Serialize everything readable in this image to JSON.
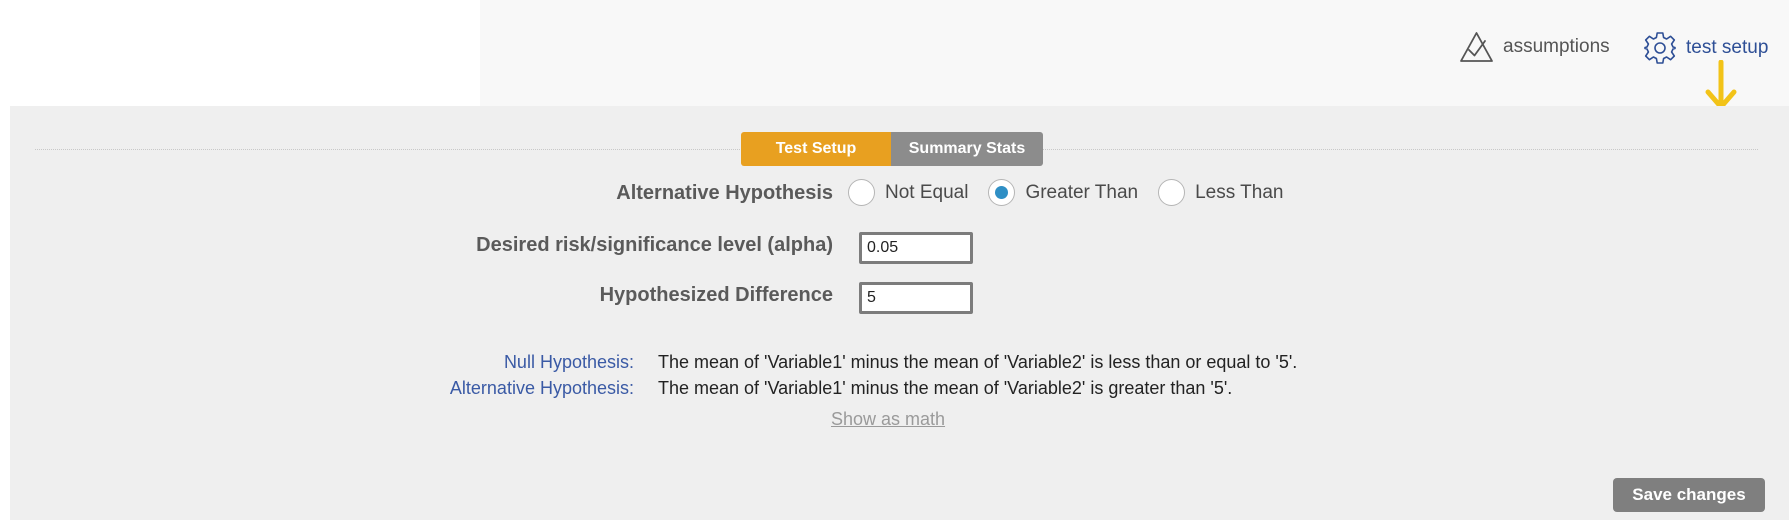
{
  "header": {
    "assumptions_label": "assumptions",
    "assumptions_icon": "triangle-check-icon",
    "test_setup_label": "test setup",
    "test_setup_icon": "gear-icon"
  },
  "colors": {
    "tab_active": "#e8a020",
    "tab_inactive": "#8c8c8c",
    "link_blue": "#2e4f96",
    "hypothesis_label": "#3a5aa5",
    "radio_selected": "#2f8fc5",
    "arrow": "#f2c318",
    "save_button": "#7f7f7f",
    "panel_background": "#efefef"
  },
  "tabs": [
    {
      "label": "Test Setup",
      "active": true
    },
    {
      "label": "Summary Stats",
      "active": false
    }
  ],
  "form": {
    "alternative_hypothesis": {
      "label": "Alternative Hypothesis",
      "options": [
        {
          "label": "Not Equal",
          "selected": false
        },
        {
          "label": "Greater Than",
          "selected": true
        },
        {
          "label": "Less Than",
          "selected": false
        }
      ]
    },
    "alpha": {
      "label": "Desired risk/significance level (alpha)",
      "value": "0.05"
    },
    "hypothesized_difference": {
      "label": "Hypothesized Difference",
      "value": "5"
    }
  },
  "hypotheses": {
    "null_label": "Null Hypothesis:",
    "null_text": "The mean of 'Variable1' minus the mean of 'Variable2' is less than or equal to '5'.",
    "alt_label": "Alternative Hypothesis:",
    "alt_text": "The mean of 'Variable1' minus the mean of 'Variable2' is greater than '5'."
  },
  "show_math_label": "Show as math",
  "save_label": "Save changes"
}
